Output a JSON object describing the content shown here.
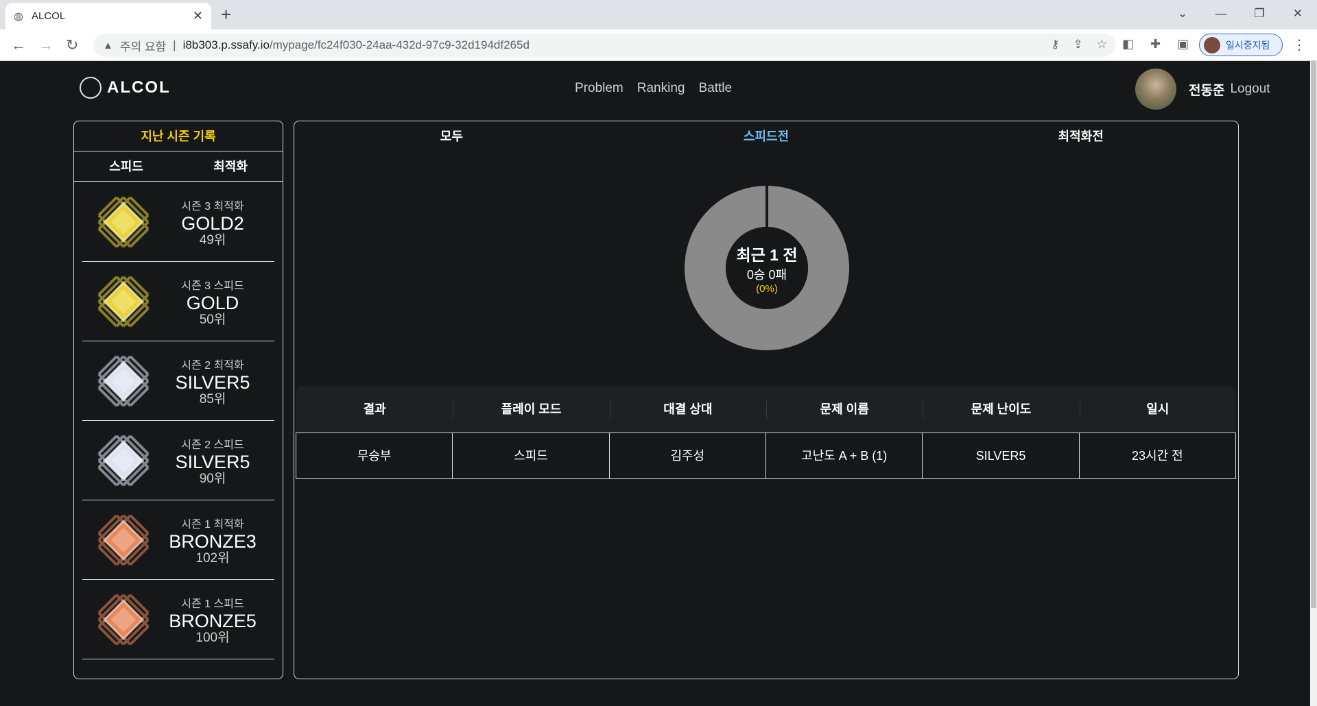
{
  "browser": {
    "tab_title": "ALCOL",
    "security_label": "주의 요함",
    "url_domain": "i8b303.p.ssafy.io",
    "url_path": "/mypage/fc24f030-24aa-432d-97c9-32d194df265d",
    "profile_label": "일시중지됨"
  },
  "header": {
    "logo": "ALCOL",
    "nav": [
      "Problem",
      "Ranking",
      "Battle"
    ],
    "user_name": "전동준",
    "logout": "Logout"
  },
  "left": {
    "title": "지난 시즌 기록",
    "tabs": [
      "스피드",
      "최적화"
    ],
    "seasons": [
      {
        "label": "시즌 3 최적화",
        "tier": "GOLD2",
        "rank": "49위",
        "badge": "gold-badge-icon",
        "color": "#e8d43a"
      },
      {
        "label": "시즌 3 스피드",
        "tier": "GOLD",
        "rank": "50위",
        "badge": "gold-badge-icon",
        "color": "#e8d43a"
      },
      {
        "label": "시즌 2 최적화",
        "tier": "SILVER5",
        "rank": "85위",
        "badge": "silver-badge-icon",
        "color": "#dde4f0"
      },
      {
        "label": "시즌 2 스피드",
        "tier": "SILVER5",
        "rank": "90위",
        "badge": "silver-badge-icon",
        "color": "#dde4f0"
      },
      {
        "label": "시즌 1 최적화",
        "tier": "BRONZE3",
        "rank": "102위",
        "badge": "bronze-badge-icon",
        "color": "#e8875a"
      },
      {
        "label": "시즌 1 스피드",
        "tier": "BRONZE5",
        "rank": "100위",
        "badge": "bronze-badge-icon",
        "color": "#e8875a"
      }
    ]
  },
  "right": {
    "tabs": [
      "모두",
      "스피드전",
      "최적화전"
    ],
    "active_tab": 1,
    "donut": {
      "title": "최근 1 전",
      "record": "0승 0패",
      "percent": "(0%)",
      "win_fraction": 0
    },
    "table": {
      "headers": [
        "결과",
        "플레이 모드",
        "대결 상대",
        "문제 이름",
        "문제 난이도",
        "일시"
      ],
      "rows": [
        [
          "무승부",
          "스피드",
          "김주성",
          "고난도 A + B (1)",
          "SILVER5",
          "23시간 전"
        ]
      ]
    }
  }
}
